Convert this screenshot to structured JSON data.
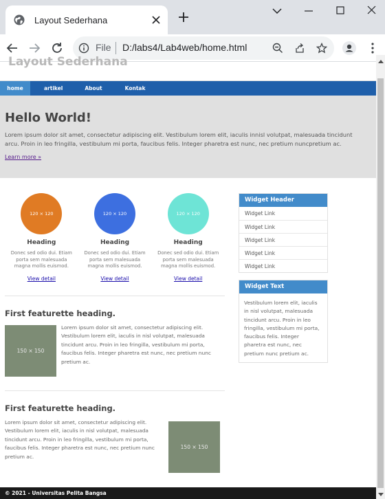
{
  "browser": {
    "tab_title": "Layout Sederhana",
    "url_scheme": "File",
    "url": "D:/labs4/Lab4web/home.html"
  },
  "site": {
    "title": "Layout Sederhana",
    "nav": [
      "home",
      "artikel",
      "About",
      "Kontak"
    ],
    "hero": {
      "heading": "Hello World!",
      "text": "Lorem ipsum dolor sit amet, consectetur adipiscing elit. Vestibulum lorem elit, iaculis innisl volutpat, malesuada tincidunt arcu. Proin in leo fringilla, vestibulum mi porta, faucibus felis. Integer pharetra est nunc, nec pretium nuncpretium ac.",
      "link": "Learn more »"
    },
    "circles": [
      {
        "placeholder": "120 × 120",
        "color": "#e07b24",
        "heading": "Heading",
        "text": "Donec sed odio dui. Etiam porta sem malesuada magna mollis euismod.",
        "link": "View detail"
      },
      {
        "placeholder": "120 × 120",
        "color": "#3d6fe0",
        "heading": "Heading",
        "text": "Donec sed odio dui. Etiam porta sem malesuada magna mollis euismod.",
        "link": "View detail"
      },
      {
        "placeholder": "120 × 120",
        "color": "#6ee4d6",
        "heading": "Heading",
        "text": "Donec sed odio dui. Etiam porta sem malesuada magna mollis euismod.",
        "link": "View detail"
      }
    ],
    "featurettes": [
      {
        "heading": "First featurette heading.",
        "image": "150 × 150",
        "text": "Lorem ipsum dolor sit amet, consectetur adipiscing elit. Vestibulum lorem elit, iaculis in nisl volutpat, malesuada tincidunt arcu. Proin in leo fringilla, vestibulum mi porta, faucibus felis. Integer pharetra est nunc, nec pretium nunc pretium ac."
      },
      {
        "heading": "First featurette heading.",
        "image": "150 × 150",
        "text": "Lorem ipsum dolor sit amet, consectetur adipiscing elit. Vestibulum lorem elit, iaculis in nisl volutpat, malesuada tincidunt arcu. Proin in leo fringilla, vestibulum mi porta, faucibus felis. Integer pharetra est nunc, nec pretium nunc pretium ac."
      }
    ],
    "widget_header": {
      "title": "Widget Header",
      "links": [
        "Widget Link",
        "Widget Link",
        "Widget Link",
        "Widget Link",
        "Widget Link"
      ]
    },
    "widget_text": {
      "title": "Widget Text",
      "text": "Vestibulum lorem elit, iaculis in nisl volutpat, malesuada tincidunt arcu. Proin in leo fringilla, vestibulum mi porta, faucibus felis. Integer pharetra est nunc, nec pretium nunc pretium ac."
    },
    "footer": "© 2021 - Universitas Pelita Bangsa"
  }
}
